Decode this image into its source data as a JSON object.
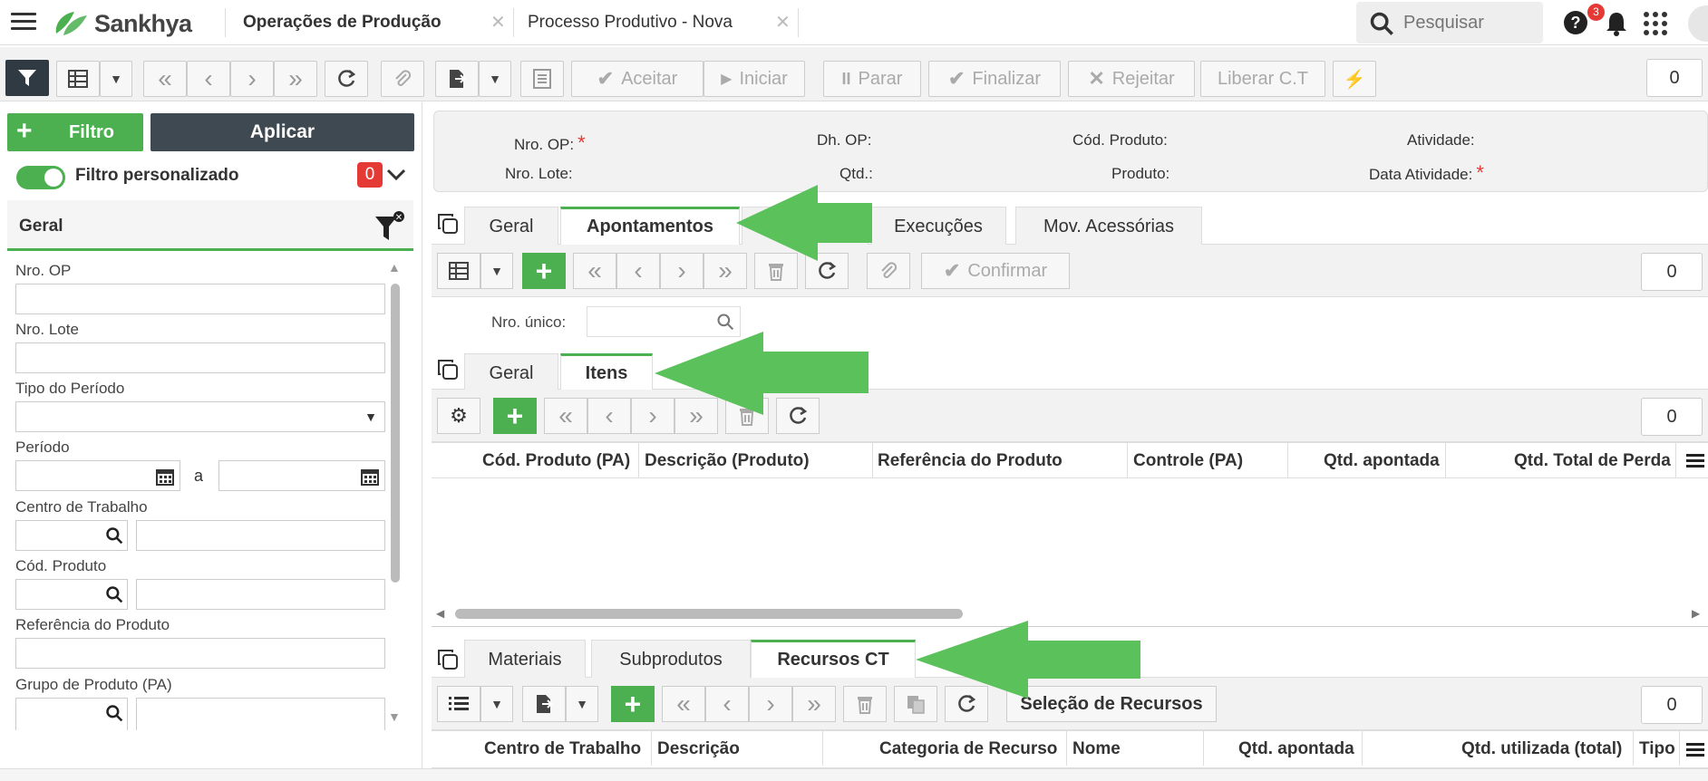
{
  "app": {
    "brand": "Sankhya",
    "brand_color": "#4caf50"
  },
  "tabs": [
    {
      "label": "Operações de Produção"
    },
    {
      "label": "Processo Produtivo - Nova"
    }
  ],
  "search": {
    "placeholder": "Pesquisar"
  },
  "notifications": {
    "count": "3"
  },
  "toolbar": {
    "aceitar": "Aceitar",
    "iniciar": "Iniciar",
    "parar": "Parar",
    "finalizar": "Finalizar",
    "rejeitar": "Rejeitar",
    "liberar": "Liberar C.T",
    "count": "0"
  },
  "filter": {
    "filtro_label": "Filtro",
    "aplicar_label": "Aplicar",
    "personalizado_label": "Filtro personalizado",
    "personalizado_count": "0",
    "section_title": "Geral",
    "fields": {
      "nro_op": "Nro. OP",
      "nro_lote": "Nro. Lote",
      "tipo_periodo": "Tipo do Período",
      "periodo": "Período",
      "periodo_sep": "a",
      "centro_trabalho": "Centro de Trabalho",
      "cod_produto": "Cód. Produto",
      "referencia_produto": "Referência do Produto",
      "grupo_produto": "Grupo de Produto (PA)"
    }
  },
  "header": {
    "nro_op": "Nro. OP:",
    "dh_op": "Dh. OP:",
    "cod_produto": "Cód. Produto:",
    "atividade": "Atividade:",
    "nro_lote": "Nro. Lote:",
    "qtd": "Qtd.:",
    "produto": "Produto:",
    "data_atividade": "Data Atividade:",
    "required_mark": "*"
  },
  "main_tabs": [
    {
      "label": "Geral"
    },
    {
      "label": "Apontamentos"
    },
    {
      "label": "Execuções"
    },
    {
      "label": "Mov. Acessórias"
    }
  ],
  "apontamentos": {
    "confirmar": "Confirmar",
    "count": "0",
    "nro_unico_label": "Nro. único:"
  },
  "sub_tabs": [
    {
      "label": "Geral"
    },
    {
      "label": "Itens"
    }
  ],
  "itens": {
    "count": "0",
    "columns": [
      "Cód. Produto (PA)",
      "Descrição (Produto)",
      "Referência do Produto",
      "Controle (PA)",
      "Qtd. apontada",
      "Qtd. Total de Perda"
    ]
  },
  "bottom_tabs": [
    {
      "label": "Materiais"
    },
    {
      "label": "Subprodutos"
    },
    {
      "label": "Recursos CT"
    }
  ],
  "recursos": {
    "selecao": "Seleção de Recursos",
    "count": "0",
    "columns": [
      "Centro de Trabalho",
      "Descrição",
      "Categoria de Recurso",
      "Nome",
      "Qtd. apontada",
      "Qtd. utilizada (total)",
      "Tipo"
    ]
  }
}
